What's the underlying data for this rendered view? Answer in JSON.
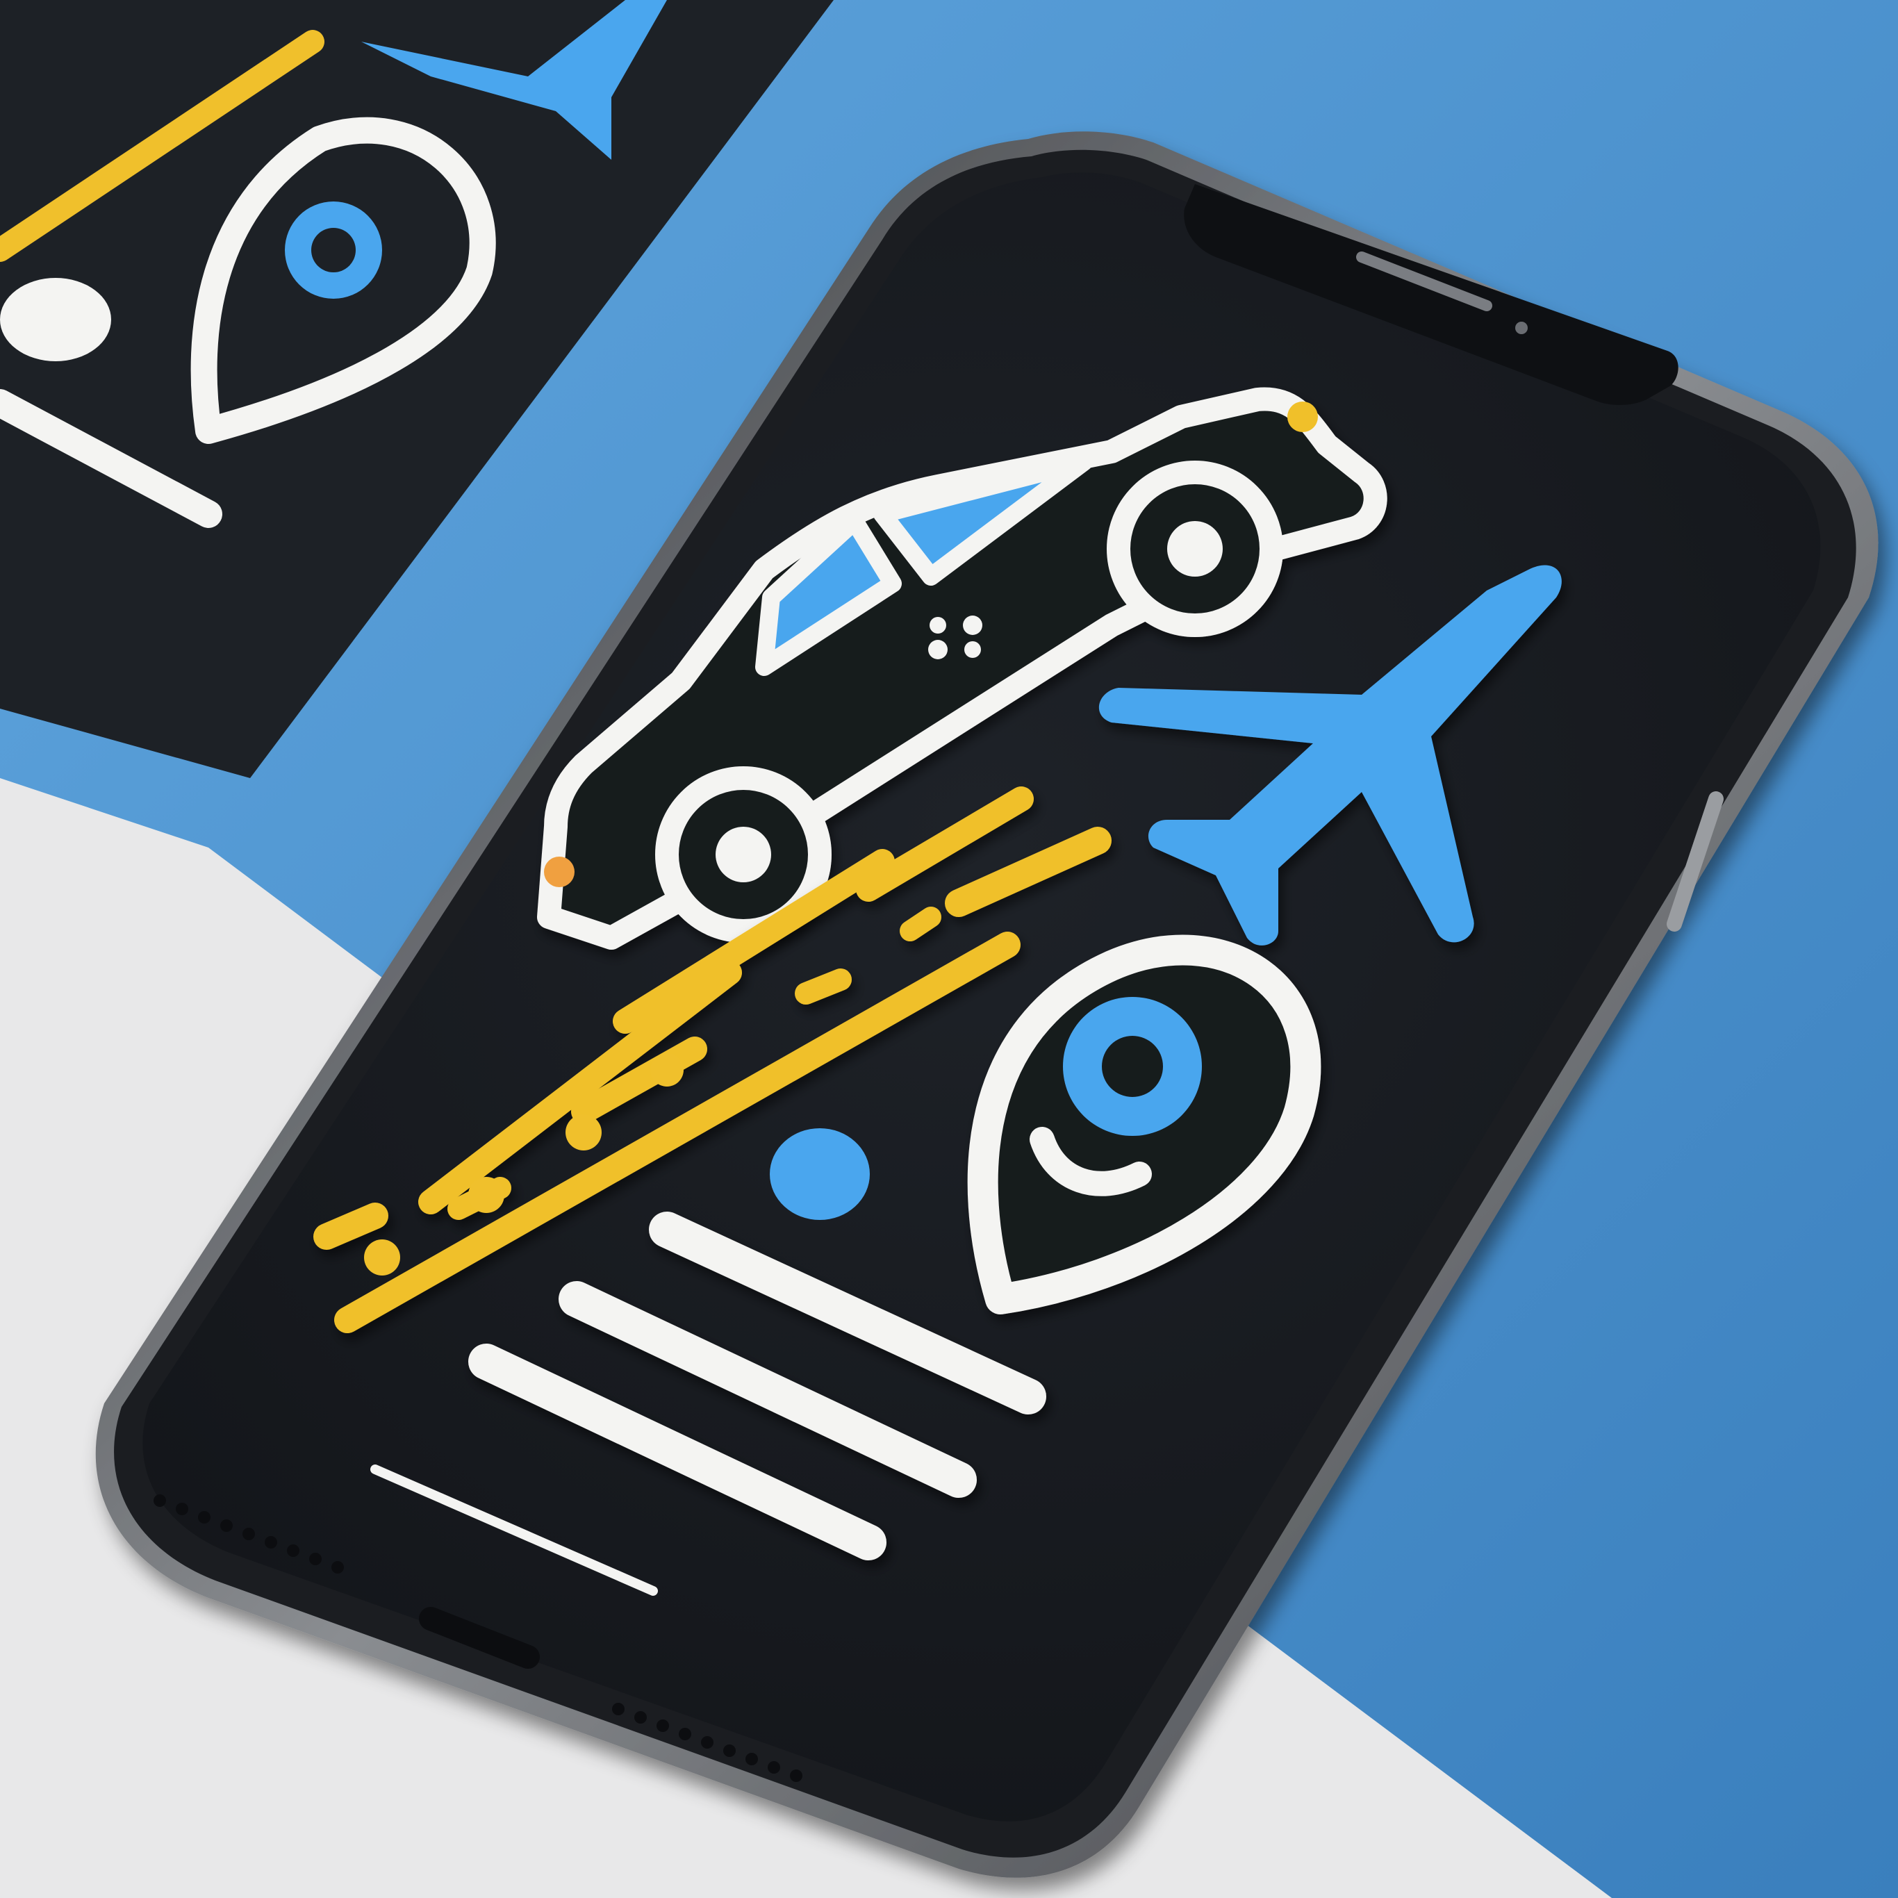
{
  "scene": {
    "description_hidden": "",
    "colors": {
      "background_light": "#e9e9ea",
      "background_blue": "#4a8fcb",
      "phone_body": "#1c1e22",
      "phone_frame": "#6f7276",
      "screen": "#15181c",
      "icon_white": "#f4f4f2",
      "icon_blue": "#4aa6ee",
      "icon_yellow": "#f0c02c"
    },
    "icons": [
      "car-icon",
      "airplane-icon",
      "map-pin-icon",
      "road-lines-icon",
      "menu-lines-icon"
    ],
    "text": {}
  }
}
